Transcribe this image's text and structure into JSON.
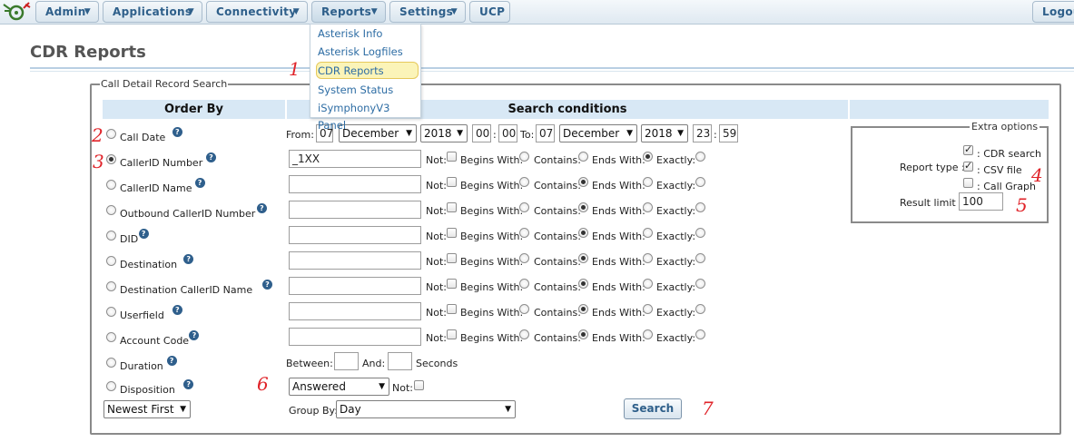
{
  "nav": {
    "menus": [
      {
        "label": "Admin",
        "caret": "▼"
      },
      {
        "label": "Applications",
        "caret": "▼"
      },
      {
        "label": "Connectivity",
        "caret": "▼"
      },
      {
        "label": "Reports",
        "caret": "▼"
      },
      {
        "label": "Settings",
        "caret": "▼"
      },
      {
        "label": "UCP",
        "caret": ""
      }
    ],
    "logout": "Logou"
  },
  "reports_menu": [
    "Asterisk Info",
    "Asterisk Logfiles",
    "CDR Reports",
    "System Status",
    "iSymphonyV3 Panel"
  ],
  "page_title": "CDR Reports",
  "search_box": {
    "legend": "Call Detail Record Search",
    "header_order_by": "Order By",
    "header_search_conditions": "Search conditions"
  },
  "order_by_fields": [
    "Call Date",
    "CallerID Number",
    "CallerID Name",
    "Outbound CallerID Number",
    "DID",
    "Destination",
    "Destination CallerID Name",
    "Userfield",
    "Account Code",
    "Duration",
    "Disposition"
  ],
  "order_by_selected": "CallerID Number",
  "date_range": {
    "from_label": "From:",
    "from_day": "07",
    "from_month": "December",
    "from_year": "2018",
    "from_hour": "00",
    "from_min": "00",
    "to_label": "To:",
    "to_day": "07",
    "to_month": "December",
    "to_year": "2018",
    "to_hour": "23",
    "to_min": "59",
    "sep": ":"
  },
  "match_labels": {
    "not": "Not:",
    "begins": "Begins With:",
    "contains": "Contains:",
    "ends": "Ends With:",
    "exactly": "Exactly:"
  },
  "text_conditions": [
    {
      "value": "_1XX",
      "mode": "ends"
    },
    {
      "value": "",
      "mode": "contains"
    },
    {
      "value": "",
      "mode": "contains"
    },
    {
      "value": "",
      "mode": "contains"
    },
    {
      "value": "",
      "mode": "contains"
    },
    {
      "value": "",
      "mode": "contains"
    },
    {
      "value": "",
      "mode": "contains"
    },
    {
      "value": "",
      "mode": "contains"
    }
  ],
  "duration": {
    "between": "Between:",
    "and": "And:",
    "seconds": "Seconds",
    "min": "",
    "max": ""
  },
  "disposition": {
    "value": "Answered",
    "not": "Not:"
  },
  "sort_order": "Newest First",
  "group_by": {
    "label": "Group By:",
    "value": "Day"
  },
  "search_button": "Search",
  "extra_options": {
    "legend": "Extra options",
    "report_type_label": "Report type :",
    "types": [
      {
        "label": ": CDR search",
        "checked": true
      },
      {
        "label": ": CSV file",
        "checked": true
      },
      {
        "label": ": Call Graph",
        "checked": false
      }
    ],
    "result_limit_label": "Result limit :",
    "result_limit": "100"
  },
  "annotations": [
    "1",
    "2",
    "3",
    "4",
    "5",
    "6",
    "7"
  ]
}
